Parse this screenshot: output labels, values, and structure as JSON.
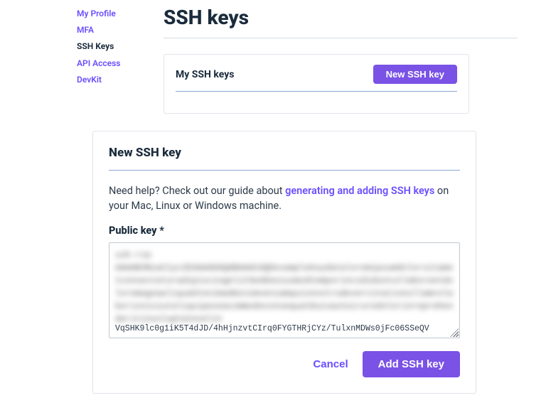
{
  "sidebar": {
    "items": [
      {
        "label": "My Profile"
      },
      {
        "label": "MFA"
      },
      {
        "label": "SSH Keys"
      },
      {
        "label": "API Access"
      },
      {
        "label": "DevKit"
      }
    ]
  },
  "page": {
    "title": "SSH keys"
  },
  "keysCard": {
    "title": "My SSH keys",
    "newBtn": "New SSH key"
  },
  "form": {
    "title": "New SSH key",
    "helpPrefix": "Need help? Check out our guide about ",
    "helpLink": "generating and adding SSH keys",
    "helpSuffix": " on your Mac, Linux or Windows machine.",
    "fieldLabel": "Public key *",
    "blurredValue": "ssh-rsa AAAAB3NzaC1yc2EAAAADAQABAAACAQDexamplekeydataloremipsumdolorsitametconsecteturadipiscingelitSeddoeiusmodtemporincididuntutlaboreetdoloremagnaaliquaUtenimadminimveniamquisnostrudexercitationullamcolaborisnisiutaliquipexeacommodoconsequatDuisauteiruredolorinreprehenderitinvoluptatevelit",
    "visibleValue": "VqSHK9lc0g1iK5T4dJD/4hHjnzvtCIrq0FYGTHRjCYz/TulxnMDWs0jFc06SSeQV",
    "cancel": "Cancel",
    "submit": "Add SSH key"
  }
}
